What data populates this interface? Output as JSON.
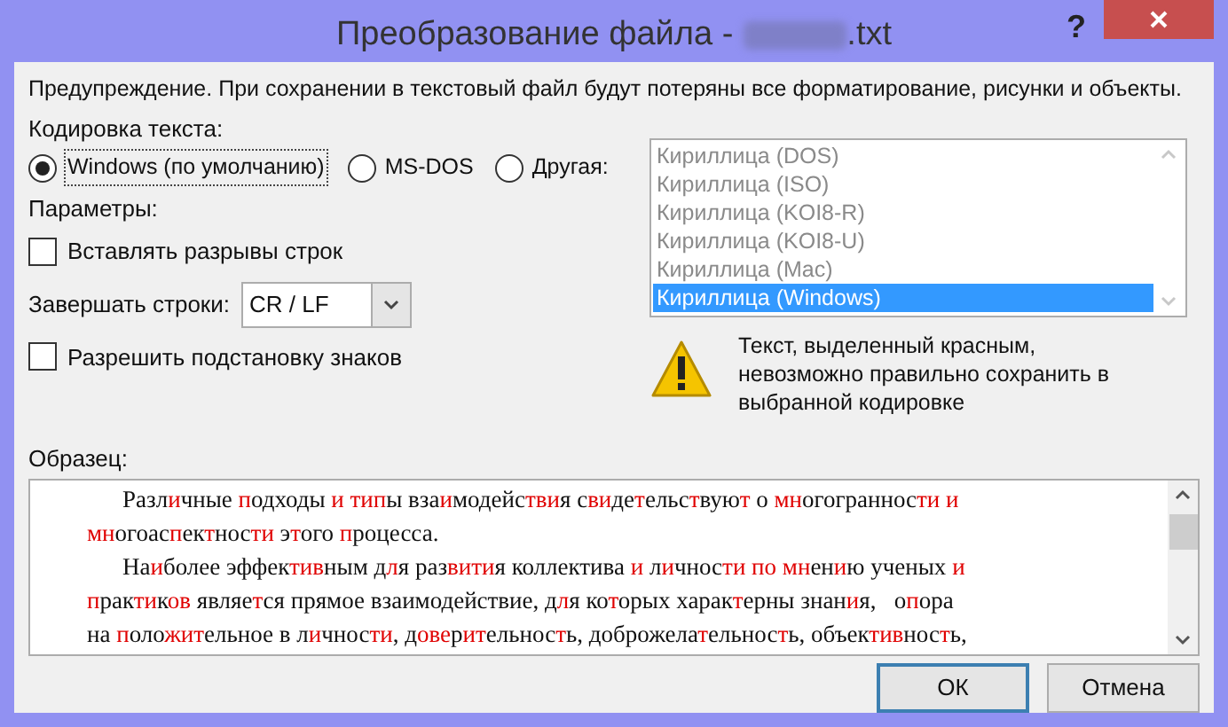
{
  "window": {
    "title_prefix": "Преобразование файла -",
    "title_suffix": ".txt",
    "help": "?"
  },
  "warning_text": "Предупреждение. При сохранении в текстовый файл будут потеряны все форматирование, рисунки и объекты.",
  "encoding_label": "Кодировка текста:",
  "encoding_options": [
    {
      "label": "Windows (по умолчанию)",
      "selected": true
    },
    {
      "label": "MS-DOS",
      "selected": false
    },
    {
      "label": "Другая:",
      "selected": false
    }
  ],
  "encodings": [
    {
      "label": "Кириллица (DOS)",
      "selected": false
    },
    {
      "label": "Кириллица (ISO)",
      "selected": false
    },
    {
      "label": "Кириллица (KOI8-R)",
      "selected": false
    },
    {
      "label": "Кириллица (KOI8-U)",
      "selected": false
    },
    {
      "label": "Кириллица (Mac)",
      "selected": false
    },
    {
      "label": "Кириллица (Windows)",
      "selected": true
    }
  ],
  "params_label": "Параметры:",
  "insert_breaks": {
    "label": "Вставлять разрывы строк",
    "checked": false
  },
  "line_end": {
    "label": "Завершать строки:",
    "value": "CR / LF"
  },
  "allow_substitution": {
    "label": "Разрешить подстановку знаков",
    "checked": false
  },
  "notice": "Текст, выделенный красным, невозможно правильно сохранить в выбранной кодировке",
  "sample_label": "Образец:",
  "sample_lines": [
    {
      "indent": true,
      "runs": [
        {
          "text": "Разл",
          "red": false
        },
        {
          "text": "и",
          "red": true
        },
        {
          "text": "чные ",
          "red": false
        },
        {
          "text": "п",
          "red": true
        },
        {
          "text": "одходы ",
          "red": false
        },
        {
          "text": "и ",
          "red": true
        },
        {
          "text": "тип",
          "red": true
        },
        {
          "text": "ы вза",
          "red": false
        },
        {
          "text": "и",
          "red": true
        },
        {
          "text": "модейс",
          "red": false
        },
        {
          "text": "тви",
          "red": true
        },
        {
          "text": "я с",
          "red": false
        },
        {
          "text": "ви",
          "red": true
        },
        {
          "text": "де",
          "red": false
        },
        {
          "text": "т",
          "red": true
        },
        {
          "text": "ельс",
          "red": false
        },
        {
          "text": "т",
          "red": true
        },
        {
          "text": "вую",
          "red": false
        },
        {
          "text": "т",
          "red": true
        },
        {
          "text": " о ",
          "red": false
        },
        {
          "text": "мн",
          "red": true
        },
        {
          "text": "огограннос",
          "red": false
        },
        {
          "text": "ти ",
          "red": true
        },
        {
          "text": "и",
          "red": true
        }
      ]
    },
    {
      "indent": false,
      "runs": [
        {
          "text": "мн",
          "red": true
        },
        {
          "text": "огоас",
          "red": false
        },
        {
          "text": "п",
          "red": true
        },
        {
          "text": "ек",
          "red": false
        },
        {
          "text": "т",
          "red": true
        },
        {
          "text": "нос",
          "red": false
        },
        {
          "text": "ти",
          "red": true
        },
        {
          "text": " э",
          "red": false
        },
        {
          "text": "т",
          "red": true
        },
        {
          "text": "ого ",
          "red": false
        },
        {
          "text": "п",
          "red": true
        },
        {
          "text": "роцесса.",
          "red": false
        }
      ]
    },
    {
      "indent": true,
      "runs": [
        {
          "text": "На",
          "red": false
        },
        {
          "text": "и",
          "red": true
        },
        {
          "text": "более эффек",
          "red": false
        },
        {
          "text": "тив",
          "red": true
        },
        {
          "text": "ным д",
          "red": false
        },
        {
          "text": "л",
          "red": true
        },
        {
          "text": "я раз",
          "red": false
        },
        {
          "text": "вити",
          "red": true
        },
        {
          "text": "я коллектива ",
          "red": false
        },
        {
          "text": "и",
          "red": true
        },
        {
          "text": " л",
          "red": false
        },
        {
          "text": "и",
          "red": true
        },
        {
          "text": "чнос",
          "red": false
        },
        {
          "text": "ти ",
          "red": true
        },
        {
          "text": "по ",
          "red": true
        },
        {
          "text": "мн",
          "red": true
        },
        {
          "text": "ен",
          "red": false
        },
        {
          "text": "и",
          "red": true
        },
        {
          "text": "ю ученых ",
          "red": false
        },
        {
          "text": "и",
          "red": true
        }
      ]
    },
    {
      "indent": false,
      "runs": [
        {
          "text": "п",
          "red": true
        },
        {
          "text": "рак",
          "red": false
        },
        {
          "text": "ти",
          "red": true
        },
        {
          "text": "к",
          "red": false
        },
        {
          "text": "ов",
          "red": true
        },
        {
          "text": " являе",
          "red": false
        },
        {
          "text": "т",
          "red": true
        },
        {
          "text": "ся прямое взаимодействие, д",
          "red": false
        },
        {
          "text": "л",
          "red": true
        },
        {
          "text": "я ко",
          "red": false
        },
        {
          "text": "т",
          "red": true
        },
        {
          "text": "орых харак",
          "red": false
        },
        {
          "text": "т",
          "red": true
        },
        {
          "text": "ерны знан",
          "red": false
        },
        {
          "text": "и",
          "red": true
        },
        {
          "text": "я,   о",
          "red": false
        },
        {
          "text": "п",
          "red": true
        },
        {
          "text": "ора",
          "red": false
        }
      ]
    },
    {
      "indent": false,
      "runs": [
        {
          "text": "на ",
          "red": false
        },
        {
          "text": "п",
          "red": true
        },
        {
          "text": "оло",
          "red": false
        },
        {
          "text": "жит",
          "red": true
        },
        {
          "text": "ельное в л",
          "red": false
        },
        {
          "text": "и",
          "red": true
        },
        {
          "text": "чнос",
          "red": false
        },
        {
          "text": "ти",
          "red": true
        },
        {
          "text": ", д",
          "red": false
        },
        {
          "text": "ове",
          "red": true
        },
        {
          "text": "р",
          "red": false
        },
        {
          "text": "ит",
          "red": true
        },
        {
          "text": "ельнос",
          "red": false
        },
        {
          "text": "т",
          "red": true
        },
        {
          "text": "ь, доброжела",
          "red": false
        },
        {
          "text": "т",
          "red": true
        },
        {
          "text": "ельнос",
          "red": false
        },
        {
          "text": "т",
          "red": true
        },
        {
          "text": "ь, объек",
          "red": false
        },
        {
          "text": "тив",
          "red": true
        },
        {
          "text": "нос",
          "red": false
        },
        {
          "text": "т",
          "red": true
        },
        {
          "text": "ь,",
          "red": false
        }
      ]
    }
  ],
  "buttons": [
    {
      "label": "ОК",
      "kind": "default"
    },
    {
      "label": "Отмена",
      "kind": "normal"
    }
  ]
}
